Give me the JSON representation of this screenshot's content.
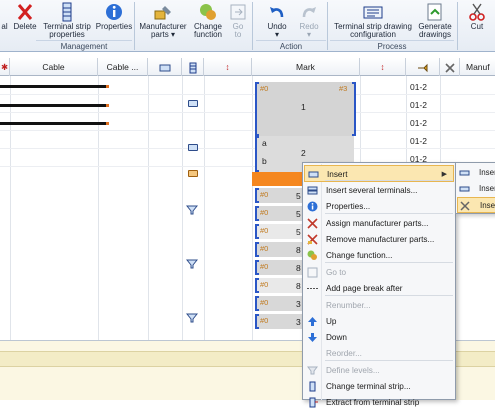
{
  "ribbon": {
    "buttons": [
      {
        "id": "partial",
        "label": "al"
      },
      {
        "id": "delete",
        "label": "Delete"
      },
      {
        "id": "terminal_strip_properties",
        "label": "Terminal strip\nproperties"
      },
      {
        "id": "properties",
        "label": "Properties"
      },
      {
        "id": "manufacturer_parts",
        "label": "Manufacturer\nparts ▾"
      },
      {
        "id": "change_function",
        "label": "Change\nfunction"
      },
      {
        "id": "go_to",
        "label": "Go\nto"
      },
      {
        "id": "undo",
        "label": "Undo\n▾"
      },
      {
        "id": "redo",
        "label": "Redo\n▾"
      },
      {
        "id": "terminal_strip_drawing_configuration",
        "label": "Terminal strip drawing\nconfiguration"
      },
      {
        "id": "generate_drawings",
        "label": "Generate\ndrawings"
      },
      {
        "id": "cut",
        "label": "Cut"
      }
    ],
    "groups": {
      "management": "Management",
      "action": "Action",
      "process": "Process"
    }
  },
  "grid": {
    "headers": {
      "cable": "Cable",
      "cable2": "Cable ...",
      "mark": "Mark",
      "manuf": "Manuf"
    },
    "rows_col401": [
      "01-2",
      "01-2",
      "01-2",
      "01-2",
      "01-2"
    ],
    "group1": {
      "hash_left": "#0",
      "hash_right": "#3",
      "value": "1"
    },
    "group2": {
      "a": "a",
      "b": "b",
      "value": "2"
    },
    "small_rows": [
      {
        "hash": "#0",
        "num": "5"
      },
      {
        "hash": "#0",
        "num": "5"
      },
      {
        "hash": "#0",
        "num": "5"
      },
      {
        "hash": "#0",
        "num": "8"
      },
      {
        "hash": "#0",
        "num": "8"
      },
      {
        "hash": "#0",
        "num": "8"
      },
      {
        "hash": "#0",
        "num": "3"
      },
      {
        "hash": "#0",
        "num": "3"
      }
    ]
  },
  "context_menu": {
    "items": [
      {
        "label": "Insert",
        "icon": "insert-icon",
        "highlight": true,
        "submenu": true,
        "disabled": false
      },
      {
        "label": "Insert several terminals...",
        "icon": "insert-several-icon",
        "disabled": false
      },
      {
        "label": "Properties...",
        "icon": "properties-icon",
        "disabled": false
      },
      {
        "label": "Assign manufacturer parts...",
        "icon": "assign-parts-icon",
        "disabled": false
      },
      {
        "label": "Remove manufacturer parts...",
        "icon": "remove-parts-icon",
        "disabled": false
      },
      {
        "label": "Change function...",
        "icon": "change-function-icon",
        "disabled": false
      },
      {
        "label": "Go to",
        "icon": "goto-icon",
        "disabled": true
      },
      {
        "label": "Add page break after",
        "icon": "page-break-icon",
        "disabled": false
      },
      {
        "label": "Renumber...",
        "icon": "",
        "disabled": true
      },
      {
        "label": "Up",
        "icon": "up-arrow-icon",
        "disabled": false
      },
      {
        "label": "Down",
        "icon": "down-arrow-icon",
        "disabled": false
      },
      {
        "label": "Reorder...",
        "icon": "",
        "disabled": true
      },
      {
        "label": "Define levels...",
        "icon": "define-levels-icon",
        "disabled": true
      },
      {
        "label": "Change terminal strip...",
        "icon": "change-strip-icon",
        "disabled": false
      },
      {
        "label": "Extract from terminal strip",
        "icon": "extract-icon",
        "disabled": false
      }
    ]
  },
  "sub_menu": {
    "items": [
      {
        "label": "Inser",
        "highlight": false
      },
      {
        "label": "Inser",
        "highlight": false
      },
      {
        "label": "Inser",
        "highlight": true
      }
    ]
  },
  "colors": {
    "accent_orange": "#f5871f",
    "highlight": "#fbe7b1",
    "bracket_blue": "#2a56c6"
  }
}
